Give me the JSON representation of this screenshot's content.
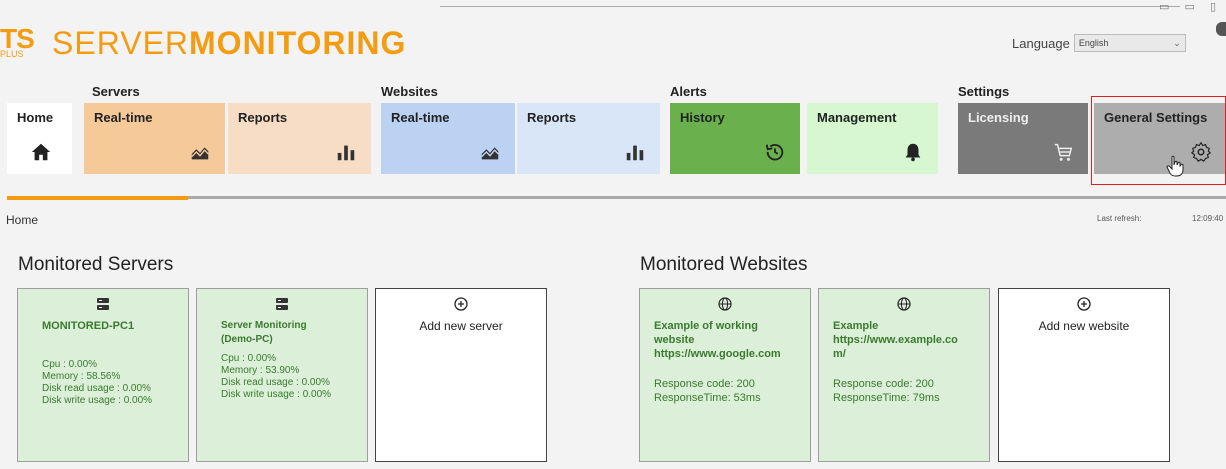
{
  "brand": {
    "ts": "TS",
    "plus": "PLUS",
    "server": "SERVER",
    "monitoring": "MONITORING"
  },
  "language": {
    "label": "Language",
    "selected": "English"
  },
  "groups": {
    "servers": "Servers",
    "websites": "Websites",
    "alerts": "Alerts",
    "settings": "Settings"
  },
  "tiles": {
    "home": "Home",
    "servers_realtime": "Real-time",
    "servers_reports": "Reports",
    "websites_realtime": "Real-time",
    "websites_reports": "Reports",
    "history": "History",
    "management": "Management",
    "licensing": "Licensing",
    "general_settings": "General Settings"
  },
  "colors": {
    "brand_orange": "#f39c12",
    "servers_realtime": "#f5c998",
    "servers_reports": "#f7dcc6",
    "websites_realtime": "#bcd2f2",
    "websites_reports": "#d8e6f7",
    "history": "#6ab04c",
    "management": "#d6f7d0",
    "licensing": "#7a7a7a",
    "general_settings": "#adadad"
  },
  "breadcrumb": "Home",
  "refresh": {
    "label": "Last refresh:",
    "time": "12:09:40"
  },
  "servers_section": {
    "title": "Monitored Servers",
    "cards": [
      {
        "name": "MONITORED-PC1",
        "name2": "",
        "cpu": "Cpu : 0.00%",
        "memory": "Memory : 58.56%",
        "disk_read": "Disk read usage : 0.00%",
        "disk_write": "Disk write usage : 0.00%"
      },
      {
        "name": "Server Monitoring",
        "name2": "(Demo-PC)",
        "cpu": "Cpu : 0.00%",
        "memory": "Memory : 53.90%",
        "disk_read": "Disk read usage : 0.00%",
        "disk_write": "Disk write usage : 0.00%"
      }
    ],
    "add_label": "Add new server"
  },
  "websites_section": {
    "title": "Monitored Websites",
    "cards": [
      {
        "line1": "Example of working",
        "line2": "website",
        "line3": "https://www.google.com",
        "code": "Response code: 200",
        "time": "ResponseTime: 53ms"
      },
      {
        "line1": "Example",
        "line2": "https://www.example.co",
        "line3": "m/",
        "code": "Response code: 200",
        "time": "ResponseTime: 79ms"
      }
    ],
    "add_label": "Add new website"
  }
}
